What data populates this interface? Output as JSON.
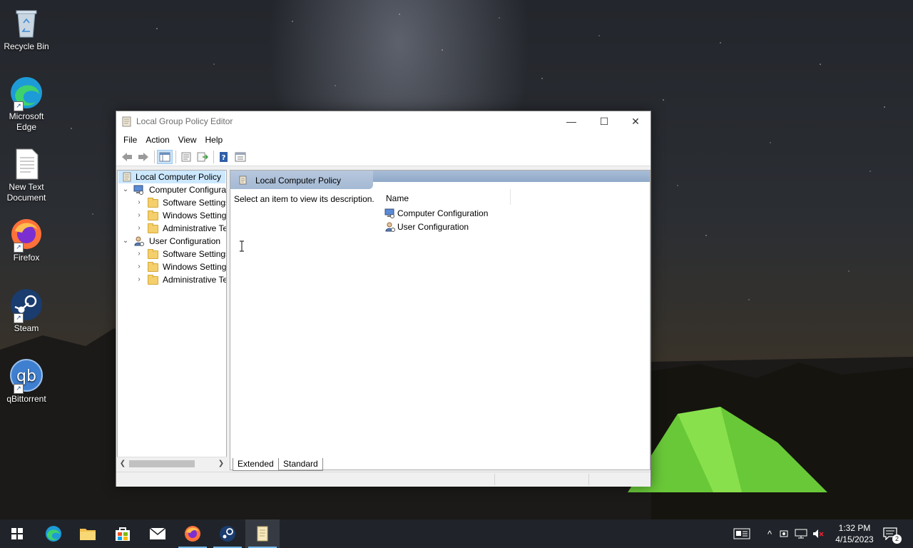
{
  "desktop": {
    "icons": [
      {
        "label": "Recycle Bin"
      },
      {
        "label": "Microsoft Edge"
      },
      {
        "label": "New Text Document"
      },
      {
        "label": "Firefox"
      },
      {
        "label": "Steam"
      },
      {
        "label": "qBittorrent"
      }
    ]
  },
  "window": {
    "title": "Local Group Policy Editor",
    "controls": {
      "minimize": "—",
      "maximize": "☐",
      "close": "✕"
    }
  },
  "menu": {
    "file": "File",
    "action": "Action",
    "view": "View",
    "help": "Help"
  },
  "tree": {
    "root": "Local Computer Policy",
    "computer": {
      "label": "Computer Configura",
      "children": [
        "Software Settings",
        "Windows Setting",
        "Administrative Te"
      ]
    },
    "user": {
      "label": "User Configuration",
      "children": [
        "Software Settings",
        "Windows Setting",
        "Administrative Te"
      ]
    }
  },
  "details": {
    "header": "Local Computer Policy",
    "description": "Select an item to view its description.",
    "column_name": "Name",
    "items": [
      "Computer Configuration",
      "User Configuration"
    ]
  },
  "tabs": {
    "extended": "Extended",
    "standard": "Standard"
  },
  "taskbar": {
    "time": "1:32 PM",
    "date": "4/15/2023",
    "notification_count": "2"
  },
  "colors": {
    "selection": "#cce8ff",
    "header_blue": "#a9bdd6",
    "taskbar": "#20242a",
    "accent": "#76b9ed"
  }
}
